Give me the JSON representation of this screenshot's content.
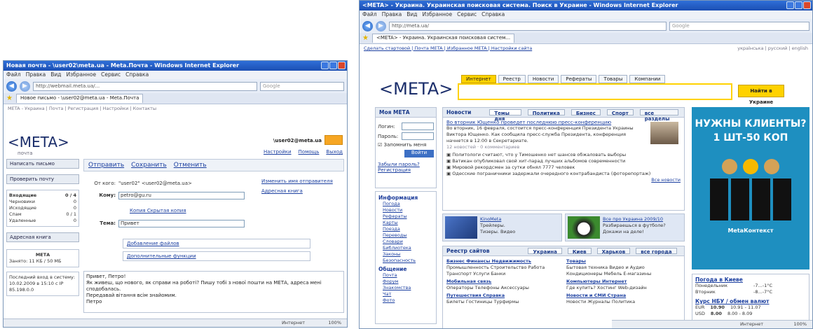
{
  "win1": {
    "title": "Новая почта - \\user02\\meta.ua - Meta.Почта - Windows Internet Explorer",
    "menu": [
      "Файл",
      "Правка",
      "Вид",
      "Избранное",
      "Сервис",
      "Справка"
    ],
    "url": "http://webmail.meta.ua/...",
    "tab_label": "Новое письмо - \\user02@meta.ua - Meta.Почта",
    "crumb": "META - Украина | Почта | Регистрация | Настройки | Контакты",
    "logo": "<META>",
    "logo_sub": "почта",
    "user_email": "\\user02@meta.ua",
    "links": [
      "Настройки",
      "Помощь",
      "Выход"
    ],
    "left": {
      "new_btn": "Написать письмо",
      "check_btn": "Проверить почту",
      "folders": [
        {
          "name": "Входящие",
          "count": "0 / 4"
        },
        {
          "name": "Черновики",
          "count": "0"
        },
        {
          "name": "Исходящие",
          "count": "0"
        },
        {
          "name": "Спам",
          "count": "0 / 1"
        },
        {
          "name": "Удаленные",
          "count": "0"
        }
      ],
      "addr_btn": "Адресная книга",
      "stats_title": "МЕТА",
      "stats_text": "Занято: 11 КБ / 50 МБ",
      "foot_text": "Последний вход в систему: 10.02.2009 в 15:10 с IP 85.198.0.0"
    },
    "toolbar": [
      "Отправить",
      "Сохранить",
      "Отменить"
    ],
    "form": {
      "from_label": "От кого:",
      "from_value": "\"user02\" <user02@meta.ua>",
      "to_label": "Кому:",
      "to_value": "petro@gu.ru",
      "side_link1": "Изменить имя отправителя",
      "side_link2": "Адресная книга",
      "cc_links": "Копия   Скрытая копия",
      "subject_label": "Тема:",
      "subject_value": "Привет",
      "attach": "Добавление файлов",
      "extra": "Дополнительные функции",
      "body": "Привет, Петро!\nЯк живеш, що нового, як справи на роботі? Пишу тобі з нової пошти на МЕТА, адреса мені сподобалась.\nПередавай вітання всім знайомим.\nПетро"
    },
    "status": "Интернет",
    "zoom": "100%"
  },
  "win2": {
    "title": "<META> - Украина. Украинская поисковая система. Поиск в Украине - Windows Internet Explorer",
    "menu": [
      "Файл",
      "Правка",
      "Вид",
      "Избранное",
      "Сервис",
      "Справка"
    ],
    "url": "http://meta.ua/",
    "search_placeholder": "Google",
    "tab_label": "<META> - Украина. Украинская поисковая систем...",
    "crumb_left": "Сделать стартовой | Почта META | Избранное META | Настройки сайта",
    "crumb_right": "українська | русский | english",
    "logo": "<META>",
    "search_tabs": [
      "Интернет",
      "Реестр",
      "Новости",
      "Рефераты",
      "Товары",
      "Компании"
    ],
    "search_btn": "Найти в Украине",
    "login": {
      "title": "Моя МЕТА",
      "login_label": "Логин:",
      "pass_label": "Пароль:",
      "remember": "Запомнить меня",
      "enter": "Войти",
      "forgot": "Забыли пароль?",
      "register": "Регистрация"
    },
    "info": {
      "title": "Информация",
      "items": [
        "Погода",
        "Новости",
        "Рефераты",
        "Карты",
        "Поезда",
        "Переводы",
        "Словари",
        "Библиотека",
        "Законы",
        "Безопасность"
      ]
    },
    "social": {
      "title": "Общение",
      "items": [
        "Почта",
        "Форум",
        "Знакомства",
        "Чат",
        "Фото"
      ]
    },
    "news": {
      "label": "Новости",
      "tabs": [
        "Темы дня",
        "Политика",
        "Бизнес",
        "Спорт",
        "все разделы"
      ],
      "headline": "Во вторник Ющенко проведет последнюю пресс-конференцию",
      "lead": "Во вторник, 16 февраля, состоится пресс-конференция Президента Украины Виктора Ющенко. Как сообщила пресс-служба Президента, конференция начнется в 12:00 в Секретариате.",
      "meta": "12 новостей · 0 комментариев",
      "items": [
        "Политологи считают, что у Тимошенко нет шансов обжаловать выборы",
        "Ватикан опубликовал свой хит-парад лучших альбомов современности",
        "Мировой рекордсмен за сутки обнял 7777 человек",
        "Одесские пограничники задержали очередного контрабандиста (фоторепортаж)"
      ],
      "all": "Все новости"
    },
    "promo": {
      "left_title": "KinoMeta",
      "left_l1": "Трейлеры.",
      "left_l2": "Тизеры. Видео",
      "right_title": "Все про Украина 2009/10",
      "right_l1": "Разбираешься в футболе?",
      "right_l2": "Докажи на деле!"
    },
    "registry": {
      "label": "Реестр сайтов",
      "tabs": [
        "Украина",
        "Киев",
        "Харьков",
        "все города"
      ],
      "cols": [
        [
          {
            "head": "Бизнес  Финансы  Недвижимость",
            "sub": "Промышленность  Строительство  Работа  Транспорт  Услуги  Банки"
          },
          {
            "head": "Мобильная связь",
            "sub": "Операторы  Телефоны  Аксессуары"
          },
          {
            "head": "Путешествия  Справка",
            "sub": "Билеты  Гостиницы  Турфирмы"
          }
        ],
        [
          {
            "head": "Товары",
            "sub": "Бытовая техника  Видео и Аудио  Кондиционеры  Мебель  E-магазины"
          },
          {
            "head": "Компьютеры  Интернет",
            "sub": "Где купить?  Хостинг  Web-дизайн"
          },
          {
            "head": "Новости и СМИ  Страна",
            "sub": "Новости  Журналы  Политика"
          }
        ]
      ]
    },
    "ad": {
      "l1": "НУЖНЫ КЛИЕНТЫ?",
      "l2": "1 ШТ-50 КОП",
      "caption": "MetaКонтекст"
    },
    "weather": {
      "title": "Погода в Киеве",
      "rows": [
        {
          "day": "Понедельник",
          "t": "-7...-1°C"
        },
        {
          "day": "Вторник",
          "t": "-8...-7°C"
        }
      ]
    },
    "rates": {
      "title": "Курс НБУ / обмен валют",
      "rows": [
        {
          "cur": "EUR",
          "v": "10.90",
          "x": "10.91 - 11.07"
        },
        {
          "cur": "USD",
          "v": "8.00",
          "x": "8.00 - 8.09"
        }
      ]
    },
    "status": "Интернет",
    "zoom": "100%"
  }
}
